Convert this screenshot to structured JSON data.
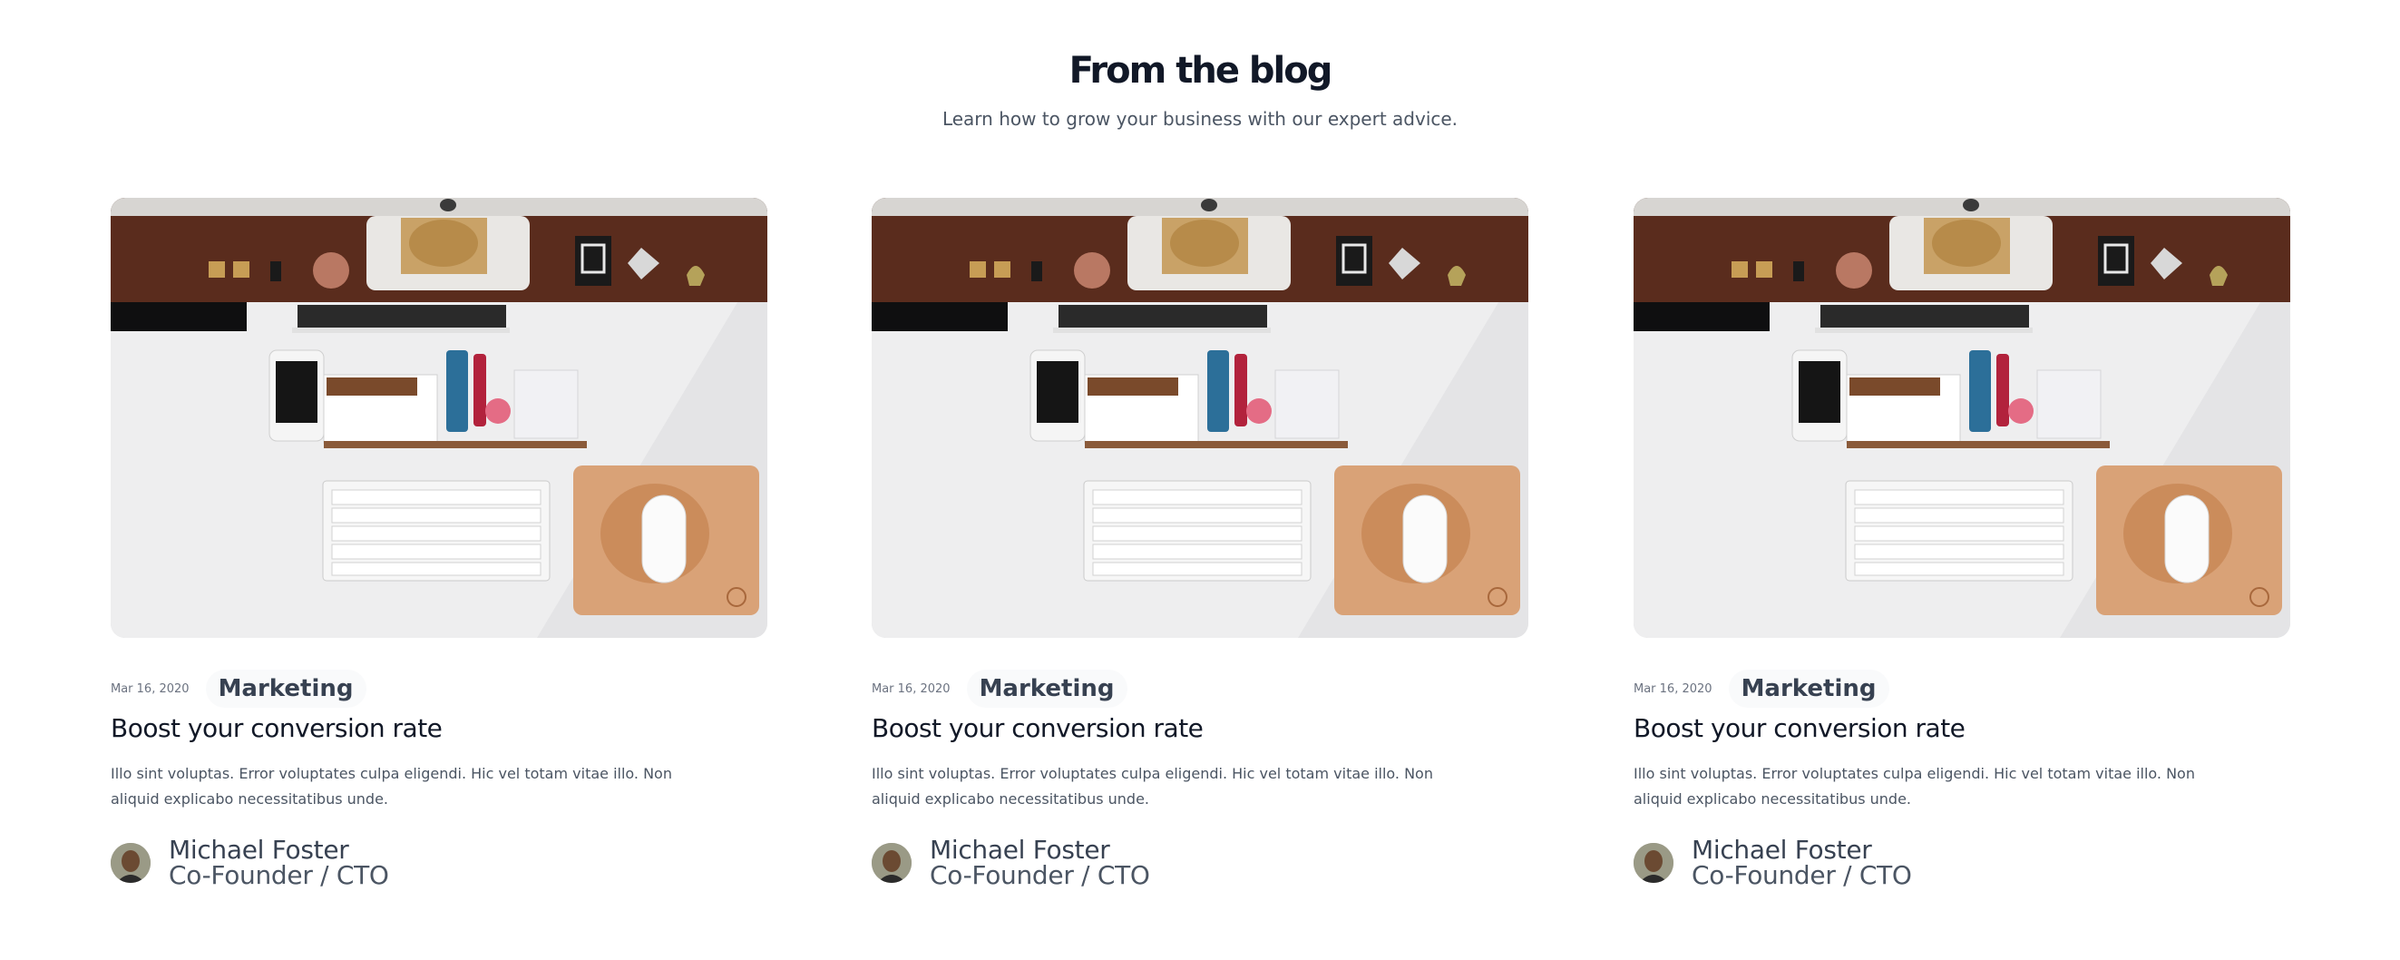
{
  "header": {
    "title": "From the blog",
    "subtitle": "Learn how to grow your business with our expert advice."
  },
  "posts": [
    {
      "date": "Mar 16, 2020",
      "category": "Marketing",
      "title": "Boost your conversion rate",
      "excerpt": "Illo sint voluptas. Error voluptates culpa eligendi. Hic vel totam vitae illo. Non aliquid explicabo necessitatibus unde.",
      "author": {
        "name": "Michael Foster",
        "role": "Co-Founder / CTO"
      }
    },
    {
      "date": "Mar 16, 2020",
      "category": "Marketing",
      "title": "Boost your conversion rate",
      "excerpt": "Illo sint voluptas. Error voluptates culpa eligendi. Hic vel totam vitae illo. Non aliquid explicabo necessitatibus unde.",
      "author": {
        "name": "Michael Foster",
        "role": "Co-Founder / CTO"
      }
    },
    {
      "date": "Mar 16, 2020",
      "category": "Marketing",
      "title": "Boost your conversion rate",
      "excerpt": "Illo sint voluptas. Error voluptates culpa eligendi. Hic vel totam vitae illo. Non aliquid explicabo necessitatibus unde.",
      "author": {
        "name": "Michael Foster",
        "role": "Co-Founder / CTO"
      }
    }
  ],
  "colors": {
    "heading": "#111827",
    "body_text": "#4b5563",
    "tag_background": "#f9fafb",
    "tag_text": "#374151"
  }
}
